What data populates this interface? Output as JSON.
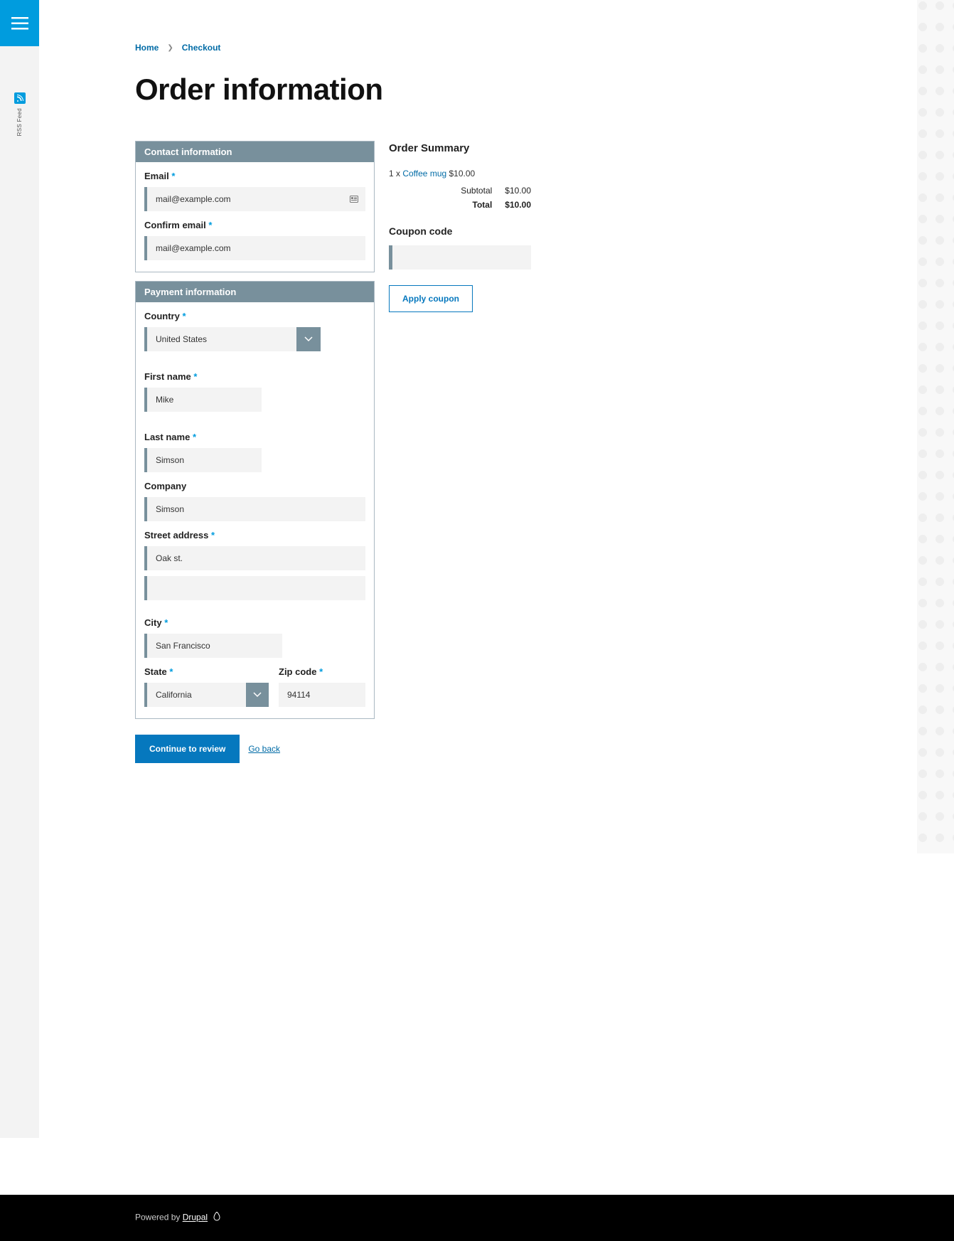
{
  "sidebar": {
    "rss_label": "RSS Feed"
  },
  "breadcrumb": {
    "home": "Home",
    "checkout": "Checkout"
  },
  "page_title": "Order information",
  "contact": {
    "header": "Contact information",
    "email_label": "Email",
    "email_value": "mail@example.com",
    "confirm_label": "Confirm email",
    "confirm_value": "mail@example.com"
  },
  "payment": {
    "header": "Payment information",
    "country_label": "Country",
    "country_value": "United States",
    "first_name_label": "First name",
    "first_name_value": "Mike",
    "last_name_label": "Last name",
    "last_name_value": "Simson",
    "company_label": "Company",
    "company_value": "Simson",
    "street_label": "Street address",
    "street_value": "Oak st.",
    "street2_value": "",
    "city_label": "City",
    "city_value": "San Francisco",
    "state_label": "State",
    "state_value": "California",
    "zip_label": "Zip code",
    "zip_value": "94114"
  },
  "actions": {
    "continue": "Continue to review",
    "back": "Go back"
  },
  "summary": {
    "title": "Order Summary",
    "line_qty": "1 x ",
    "line_product": "Coffee mug",
    "line_price": " $10.00",
    "subtotal_label": "Subtotal",
    "subtotal_value": "$10.00",
    "total_label": "Total",
    "total_value": "$10.00",
    "coupon_title": "Coupon code",
    "apply_coupon": "Apply coupon"
  },
  "footer": {
    "powered": "Powered by ",
    "drupal": "Drupal"
  }
}
